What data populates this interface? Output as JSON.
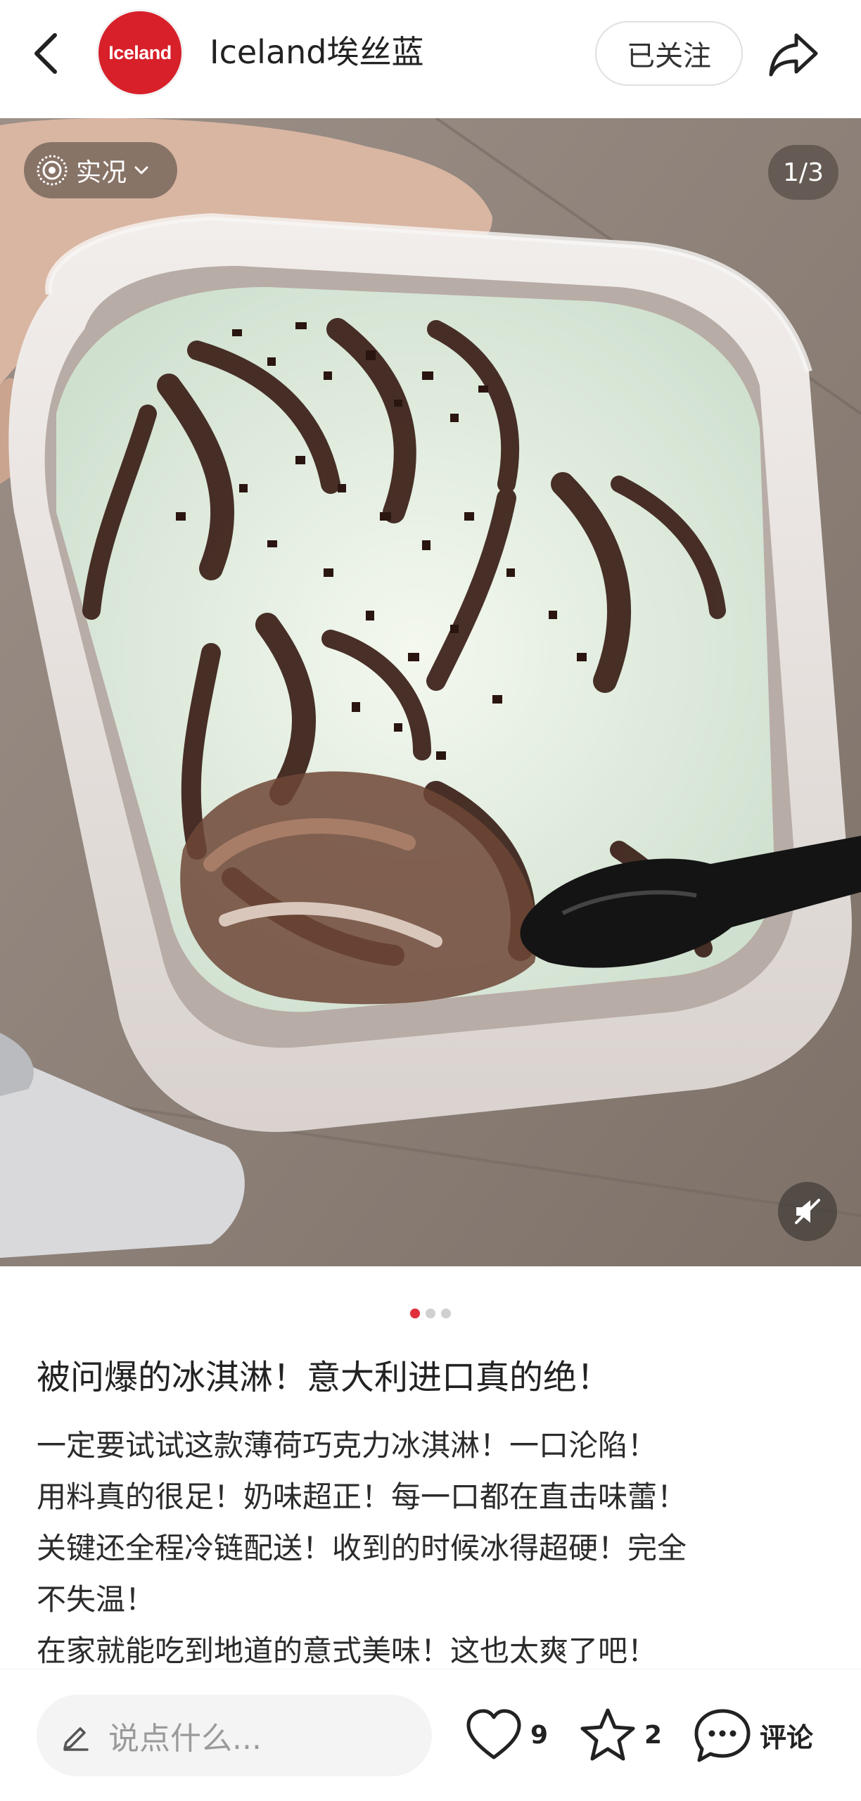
{
  "header": {
    "avatar_text": "Iceland",
    "account_name": "Iceland埃丝蓝",
    "follow_label": "已关注"
  },
  "media": {
    "live_label": "实况",
    "page_counter": "1/3",
    "pages_total": 3,
    "current_page": 1
  },
  "post": {
    "title": "被问爆的冰淇淋！意大利进口真的绝！",
    "body_lines": [
      "一定要试试这款薄荷巧克力冰淇淋！一口沦陷！",
      "用料真的很足！奶味超正！每一口都在直击味蕾！",
      "关键还全程冷链配送！收到的时候冰得超硬！完全",
      "不失温！",
      "在家就能吃到地道的意式美味！这也太爽了吧！"
    ]
  },
  "bottom_bar": {
    "comment_placeholder": "说点什么...",
    "likes": "9",
    "favorites": "2",
    "comment_label": "评论"
  },
  "colors": {
    "brand_red": "#d8202a",
    "active_dot": "#e0313c"
  },
  "icons": [
    "back-arrow-icon",
    "share-icon",
    "live-photo-icon",
    "chevron-down-icon",
    "mute-icon",
    "pen-icon",
    "heart-icon",
    "star-icon",
    "comment-bubble-icon"
  ]
}
